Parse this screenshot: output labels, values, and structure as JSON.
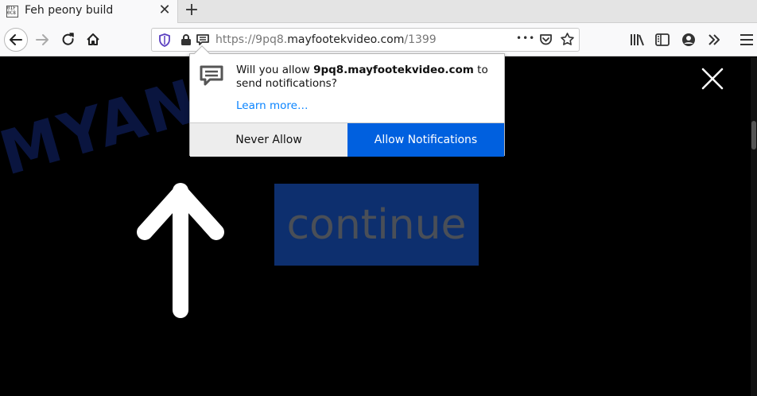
{
  "tab": {
    "title": "Feh peony build",
    "favicon_text": "01F 0C8",
    "close_glyph": "✕",
    "new_tab_glyph": "+"
  },
  "navbar": {
    "url_prefix": "https://9pq8.",
    "url_domain": "mayfootekvideo.com",
    "url_path": "/1399",
    "page_actions_glyph": "•••"
  },
  "popup": {
    "msg_before": "Will you allow ",
    "domain": "9pq8.mayfootekvideo.com",
    "msg_after": " to send notifications?",
    "learn_more": "Learn more…",
    "never_allow": "Never Allow",
    "allow_notifications": "Allow Notifications"
  },
  "page": {
    "continue_label": "continue",
    "watermark": "MYANTISPYWARE.COM"
  },
  "colors": {
    "allow_button": "#0060df",
    "continue_button": "#0d2f6e",
    "link": "#0a84ff"
  }
}
